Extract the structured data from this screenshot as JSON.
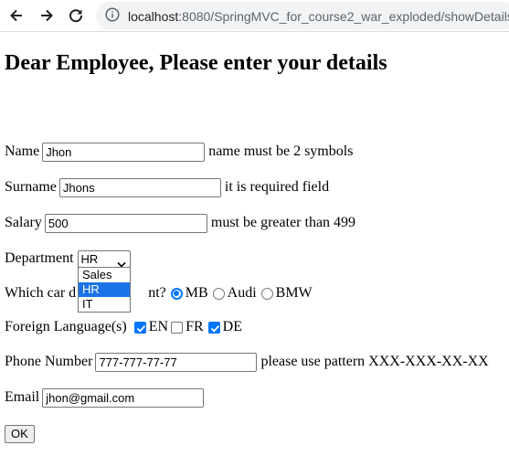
{
  "browser": {
    "url_host": "localhost",
    "url_rest": ":8080/SpringMVC_for_course2_war_exploded/showDetails",
    "icons": [
      "back-arrow-icon",
      "forward-arrow-icon",
      "reload-icon",
      "info-icon"
    ]
  },
  "page": {
    "title": "Dear Employee, Please enter your details"
  },
  "form": {
    "name": {
      "label": "Name",
      "value": "Jhon",
      "hint": "name must be 2 symbols"
    },
    "surname": {
      "label": "Surname",
      "value": "Jhons",
      "hint": "it is required field"
    },
    "salary": {
      "label": "Salary",
      "value": "500",
      "hint": "must be greater than 499"
    },
    "department": {
      "label": "Department",
      "selected": "HR",
      "options": [
        "Sales",
        "HR",
        "IT"
      ],
      "highlighted_index": 1
    },
    "car": {
      "label_start": "Which car d",
      "label_end": "nt?",
      "options": [
        {
          "label": "MB",
          "checked": true
        },
        {
          "label": "Audi",
          "checked": false
        },
        {
          "label": "BMW",
          "checked": false
        }
      ]
    },
    "languages": {
      "label": "Foreign Language(s)",
      "options": [
        {
          "label": "EN",
          "checked": true
        },
        {
          "label": "FR",
          "checked": false
        },
        {
          "label": "DE",
          "checked": true
        }
      ]
    },
    "phone": {
      "label": "Phone Number",
      "value": "777-777-77-77",
      "hint": "please use pattern XXX-XXX-XX-XX"
    },
    "email": {
      "label": "Email",
      "value": "jhon@gmail.com"
    },
    "submit_label": "OK"
  },
  "colors": {
    "accent": "#0075ff",
    "dropdown_highlight": "#1a73e8"
  }
}
